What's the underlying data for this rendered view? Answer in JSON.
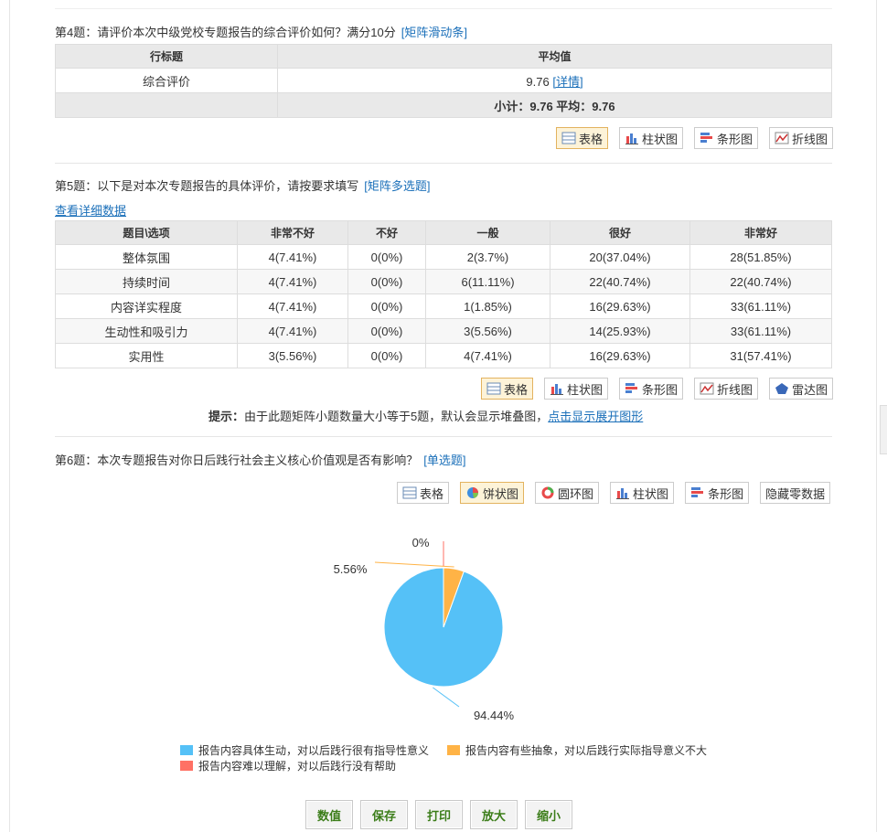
{
  "q4": {
    "title": "第4题：请评价本次中级党校专题报告的综合评价如何？满分10分",
    "type": "[矩阵滑动条]",
    "headers": [
      "行标题",
      "平均值"
    ],
    "row_label": "综合评价",
    "row_value": "9.76",
    "detail_link": "[详情]",
    "subtotal": "小计：9.76 平均：9.76",
    "buttons": [
      "表格",
      "柱状图",
      "条形图",
      "折线图"
    ]
  },
  "q5": {
    "title": "第5题：以下是对本次专题报告的具体评价，请按要求填写",
    "type": "[矩阵多选题]",
    "detail_link": "查看详细数据",
    "headers": [
      "题目\\选项",
      "非常不好",
      "不好",
      "一般",
      "很好",
      "非常好"
    ],
    "rows": [
      [
        "整体氛围",
        "4(7.41%)",
        "0(0%)",
        "2(3.7%)",
        "20(37.04%)",
        "28(51.85%)"
      ],
      [
        "持续时间",
        "4(7.41%)",
        "0(0%)",
        "6(11.11%)",
        "22(40.74%)",
        "22(40.74%)"
      ],
      [
        "内容详实程度",
        "4(7.41%)",
        "0(0%)",
        "1(1.85%)",
        "16(29.63%)",
        "33(61.11%)"
      ],
      [
        "生动性和吸引力",
        "4(7.41%)",
        "0(0%)",
        "3(5.56%)",
        "14(25.93%)",
        "33(61.11%)"
      ],
      [
        "实用性",
        "3(5.56%)",
        "0(0%)",
        "4(7.41%)",
        "16(29.63%)",
        "31(57.41%)"
      ]
    ],
    "buttons": [
      "表格",
      "柱状图",
      "条形图",
      "折线图",
      "雷达图"
    ],
    "hint_label": "提示：",
    "hint_text": "由于此题矩阵小题数量大小等于5题，默认会显示堆叠图，",
    "hint_link": "点击显示展开图形"
  },
  "q6": {
    "title": "第6题：本次专题报告对你日后践行社会主义核心价值观是否有影响？",
    "type": "[单选题]",
    "buttons": [
      "表格",
      "饼状图",
      "圆环图",
      "柱状图",
      "条形图",
      "隐藏零数据"
    ]
  },
  "chart_data": {
    "type": "pie",
    "slices": [
      {
        "label": "报告内容具体生动，对以后践行很有指导性意义",
        "value": 94.44,
        "display": "94.44%",
        "color": "#55c1f7"
      },
      {
        "label": "报告内容有些抽象，对以后践行实际指导意义不大",
        "value": 5.56,
        "display": "5.56%",
        "color": "#ffb346"
      },
      {
        "label": "报告内容难以理解，对以后践行没有帮助",
        "value": 0,
        "display": "0%",
        "color": "#ff7165"
      }
    ]
  },
  "bottom_buttons": [
    "数值",
    "保存",
    "打印",
    "放大",
    "缩小"
  ],
  "colors": {
    "link": "#1a6fb9",
    "active_button_border": "#e3b35f",
    "bottom_button_text": "#3b7d19"
  }
}
